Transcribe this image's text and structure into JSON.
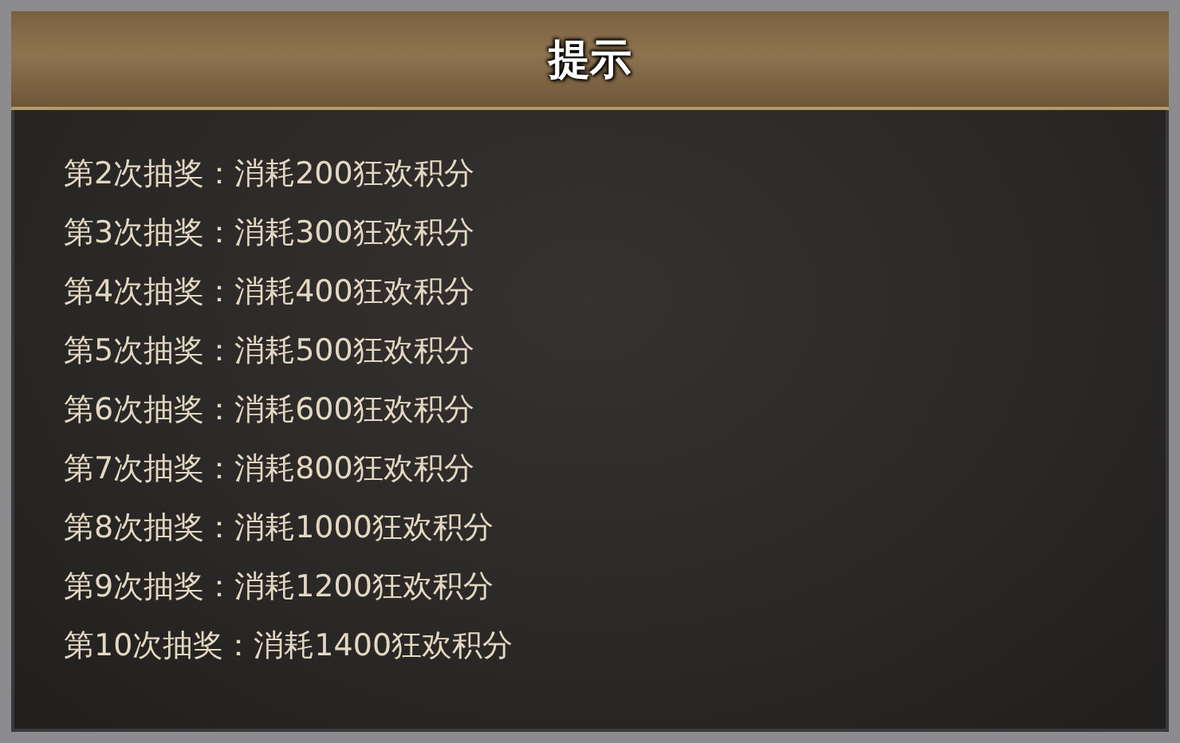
{
  "dialog": {
    "title": "提示",
    "lines": [
      "第2次抽奖：消耗200狂欢积分",
      "第3次抽奖：消耗300狂欢积分",
      "第4次抽奖：消耗400狂欢积分",
      "第5次抽奖：消耗500狂欢积分",
      "第6次抽奖：消耗600狂欢积分",
      "第7次抽奖：消耗800狂欢积分",
      "第8次抽奖：消耗1000狂欢积分",
      "第9次抽奖：消耗1200狂欢积分",
      "第10次抽奖：消耗1400狂欢积分"
    ]
  }
}
